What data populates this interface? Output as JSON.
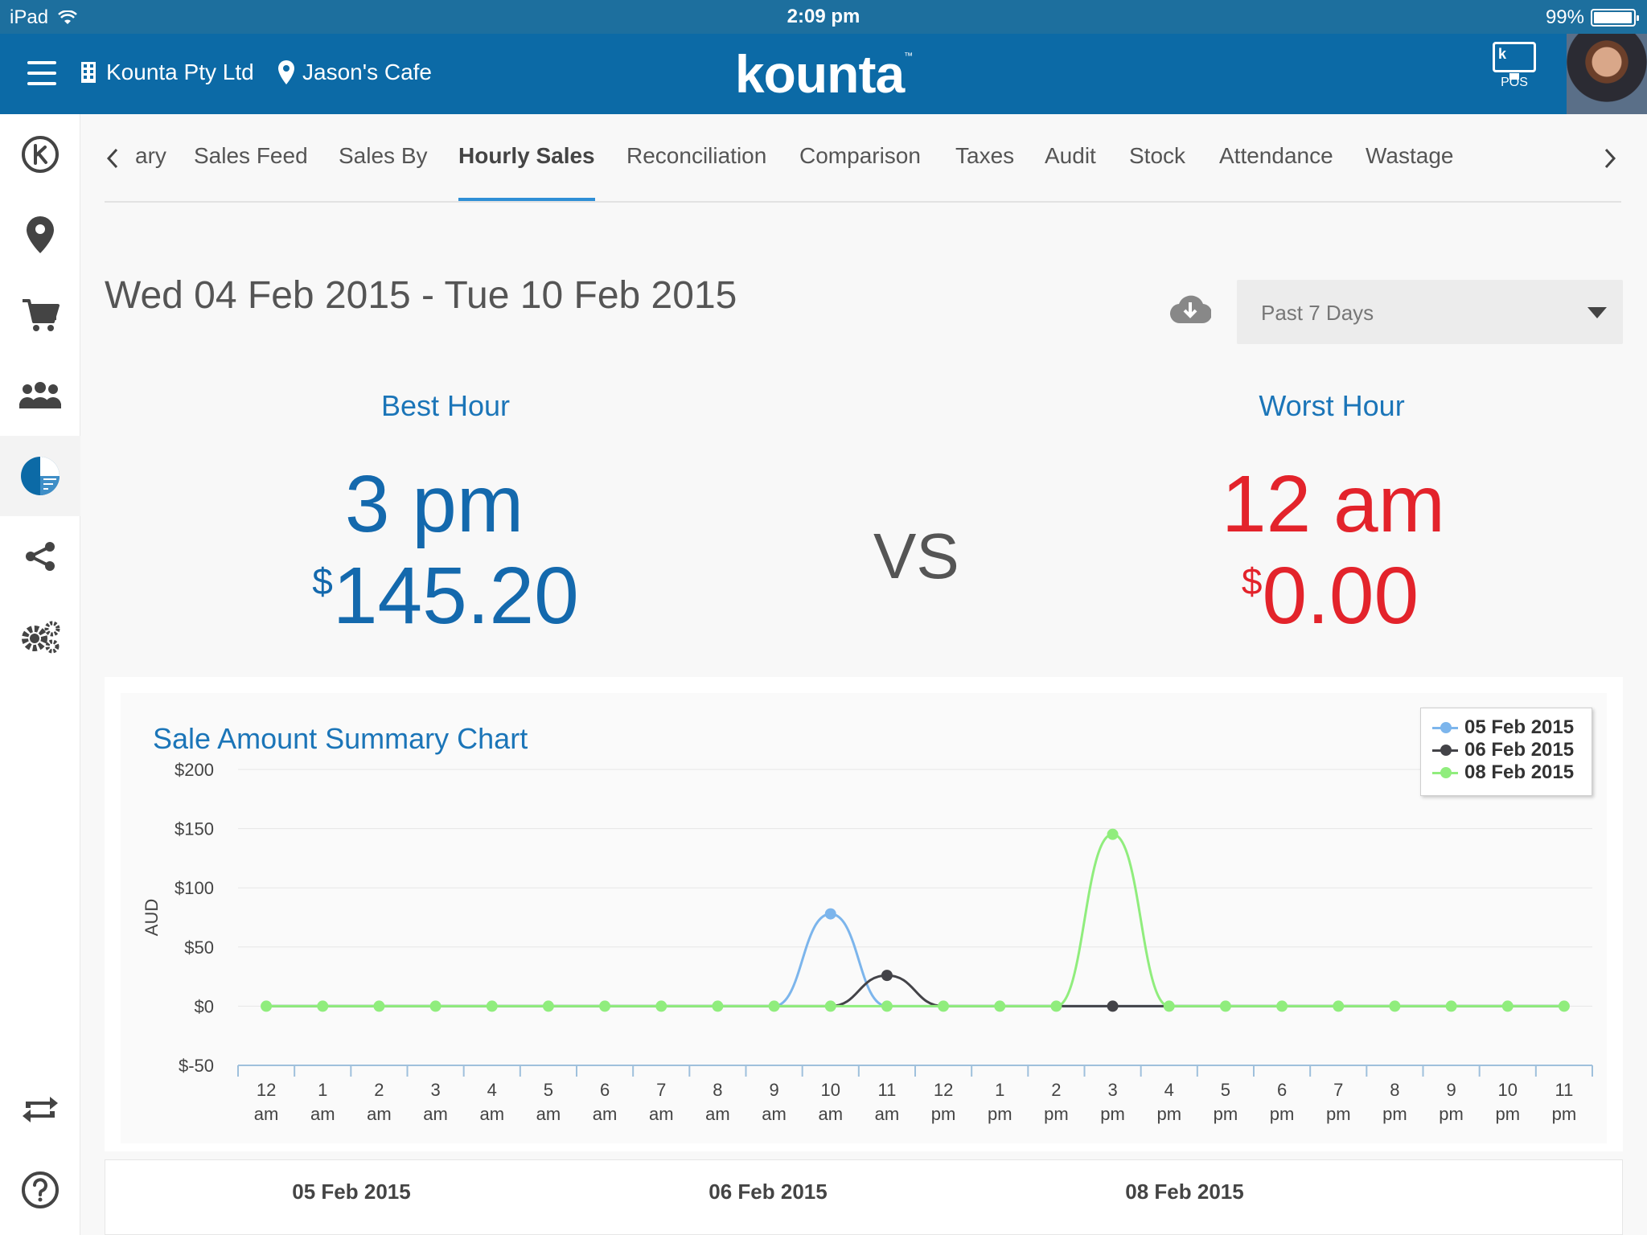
{
  "status_bar": {
    "device": "iPad",
    "time": "2:09 pm",
    "battery": "99%"
  },
  "header": {
    "company": "Kounta Pty Ltd",
    "venue": "Jason's Cafe",
    "logo": "kounta",
    "logo_tm": "™",
    "pos_label": "POS"
  },
  "tabs": {
    "items": [
      "ary",
      "Sales Feed",
      "Sales By",
      "Hourly Sales",
      "Reconciliation",
      "Comparison",
      "Taxes",
      "Audit",
      "Stock",
      "Attendance",
      "Wastage"
    ],
    "active": "Hourly Sales"
  },
  "date_range": "Wed 04 Feb 2015 - Tue 10 Feb 2015",
  "period_select": {
    "value": "Past 7 Days"
  },
  "best_hour": {
    "title": "Best Hour",
    "hour": "3 pm",
    "currency": "$",
    "amount": "145.20"
  },
  "worst_hour": {
    "title": "Worst Hour",
    "hour": "12 am",
    "currency": "$",
    "amount": "0.00"
  },
  "vs_label": "VS",
  "chart_title": "Sale Amount Summary Chart",
  "colors": {
    "brand": "#0c6aa6",
    "accent": "#2f8fd6",
    "best": "#1469ad",
    "worst": "#e3232b"
  },
  "chart_data": {
    "type": "line",
    "title": "Sale Amount Summary Chart",
    "ylabel": "AUD",
    "xlabel": "",
    "ylim": [
      -50,
      200
    ],
    "y_ticks": [
      "$200",
      "$150",
      "$100",
      "$50",
      "$0",
      "$-50"
    ],
    "y_tick_values": [
      200,
      150,
      100,
      50,
      0,
      -50
    ],
    "categories": [
      [
        "12",
        "am"
      ],
      [
        "1",
        "am"
      ],
      [
        "2",
        "am"
      ],
      [
        "3",
        "am"
      ],
      [
        "4",
        "am"
      ],
      [
        "5",
        "am"
      ],
      [
        "6",
        "am"
      ],
      [
        "7",
        "am"
      ],
      [
        "8",
        "am"
      ],
      [
        "9",
        "am"
      ],
      [
        "10",
        "am"
      ],
      [
        "11",
        "am"
      ],
      [
        "12",
        "pm"
      ],
      [
        "1",
        "pm"
      ],
      [
        "2",
        "pm"
      ],
      [
        "3",
        "pm"
      ],
      [
        "4",
        "pm"
      ],
      [
        "5",
        "pm"
      ],
      [
        "6",
        "pm"
      ],
      [
        "7",
        "pm"
      ],
      [
        "8",
        "pm"
      ],
      [
        "9",
        "pm"
      ],
      [
        "10",
        "pm"
      ],
      [
        "11",
        "pm"
      ]
    ],
    "legend_position": "top-right",
    "grid": true,
    "series": [
      {
        "name": "05 Feb 2015",
        "color": "#7cb5ec",
        "values": [
          0,
          0,
          0,
          0,
          0,
          0,
          0,
          0,
          0,
          0,
          78,
          0,
          0,
          0,
          0,
          0,
          0,
          0,
          0,
          0,
          0,
          0,
          0,
          0
        ]
      },
      {
        "name": "06 Feb 2015",
        "color": "#434348",
        "values": [
          0,
          0,
          0,
          0,
          0,
          0,
          0,
          0,
          0,
          0,
          0,
          26,
          0,
          0,
          0,
          0,
          0,
          0,
          0,
          0,
          0,
          0,
          0,
          0
        ]
      },
      {
        "name": "08 Feb 2015",
        "color": "#90ed7d",
        "values": [
          0,
          0,
          0,
          0,
          0,
          0,
          0,
          0,
          0,
          0,
          0,
          0,
          0,
          0,
          0,
          145.2,
          0,
          0,
          0,
          0,
          0,
          0,
          0,
          0
        ]
      }
    ]
  },
  "date_table": {
    "columns": [
      "05 Feb 2015",
      "06 Feb 2015",
      "08 Feb 2015"
    ]
  }
}
